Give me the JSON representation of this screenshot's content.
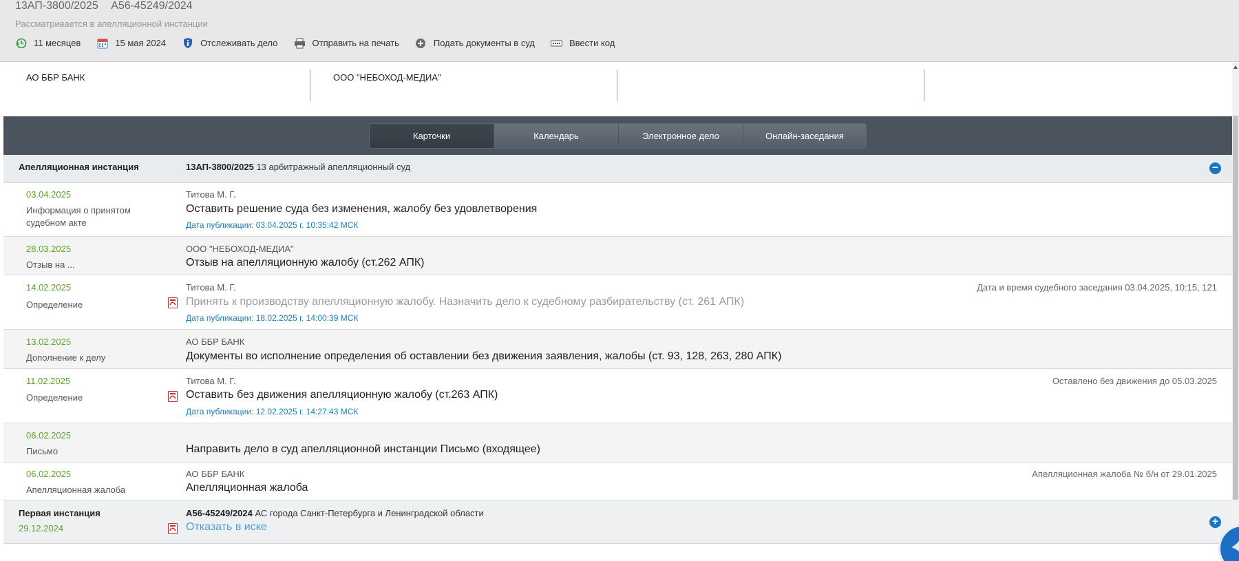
{
  "header": {
    "case_numbers": [
      "13АП-3800/2025",
      "А56-45249/2024"
    ],
    "status": "Рассматривается в апелляционной инстанции",
    "toolbar": [
      {
        "icon": "clock-back-icon",
        "label": "11 месяцев"
      },
      {
        "icon": "calendar-icon",
        "label": "15 мая 2024"
      },
      {
        "icon": "shield-info-icon",
        "label": "Отслеживать дело"
      },
      {
        "icon": "printer-icon",
        "label": "Отправить на печать"
      },
      {
        "icon": "plus-circle-icon",
        "label": "Подать документы в суд"
      },
      {
        "icon": "keyboard-icon",
        "label": "Ввести код"
      }
    ]
  },
  "parties": [
    "АО ББР БАНК",
    "ООО \"НЕБОХОД-МЕДИА\"",
    "",
    ""
  ],
  "tabs": [
    {
      "label": "Карточки",
      "active": true
    },
    {
      "label": "Календарь",
      "active": false
    },
    {
      "label": "Электронное дело",
      "active": false
    },
    {
      "label": "Онлайн-заседания",
      "active": false
    }
  ],
  "appeal": {
    "label": "Апелляционная инстанция",
    "case": "13АП-3800/2025",
    "court": "13 арбитражный апелляционный суд",
    "toggle": "−"
  },
  "entries": [
    {
      "date": "03.04.2025",
      "type": "Информация о принятом судебном акте",
      "author": "Титова М. Г.",
      "title": "Оставить решение суда без изменения, жалобу без удовлетворения",
      "pub": "Дата публикации: 03.04.2025 г. 10:35:42 МСК",
      "note": ""
    },
    {
      "date": "28.03.2025",
      "type": "Отзыв на ...",
      "author": "ООО \"НЕБОХОД-МЕДИА\"",
      "title": "Отзыв на апелляционную жалобу (ст.262 АПК)",
      "pub": "",
      "note": ""
    },
    {
      "date": "14.02.2025",
      "type": "Определение",
      "author": "Титова М. Г.",
      "title": "Принять к производству апелляционную жалобу. Назначить дело к судебному разбирательству (ст. 261 АПК)",
      "pub": "Дата публикации: 18.02.2025 г. 14:00:39 МСК",
      "note": "Дата и время судебного заседания 03.04.2025, 10:15, 121"
    },
    {
      "date": "13.02.2025",
      "type": "Дополнение к делу",
      "author": "АО ББР БАНК",
      "title": "Документы во исполнение определения об оставлении без движения заявления, жалобы (ст. 93, 128, 263, 280 АПК)",
      "pub": "",
      "note": ""
    },
    {
      "date": "11.02.2025",
      "type": "Определение",
      "author": "Титова М. Г.",
      "title": "Оставить без движения апелляционную жалобу (ст.263 АПК)",
      "pub": "Дата публикации: 12.02.2025 г. 14:27:43 МСК",
      "note": "Оставлено без движения до 05.03.2025"
    },
    {
      "date": "06.02.2025",
      "type": "Письмо",
      "author": "",
      "title": "Направить дело в суд апелляционной инстанции Письмо (входящее)",
      "pub": "",
      "note": ""
    },
    {
      "date": "06.02.2025",
      "type": "Апелляционная жалоба",
      "author": "АО ББР БАНК",
      "title": "Апелляционная жалоба",
      "pub": "",
      "note": "Апелляционная жалоба № б/н от 29.01.2025"
    }
  ],
  "first": {
    "label": "Первая инстанция",
    "date": "29.12.2024",
    "case": "А56-45249/2024",
    "court": "АС города Санкт-Петербурга и Ленинградской области",
    "title": "Отказать в иске",
    "toggle": "+"
  },
  "colors": {
    "date_green": "#5aa52a",
    "link_blue": "#1a7fc1",
    "tabs_bg": "#4a535e",
    "accent_blue": "#1a78c2"
  }
}
